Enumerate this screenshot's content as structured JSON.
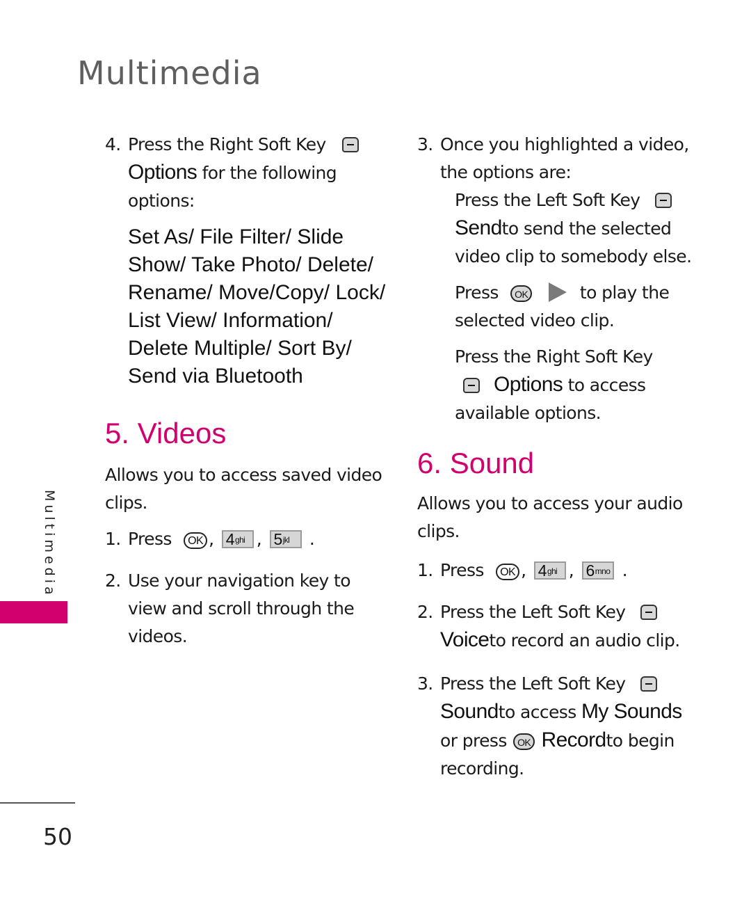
{
  "header": {
    "title": "Multimedia"
  },
  "side_tab": {
    "label": "Multimedia",
    "accent_color": "#d2006e"
  },
  "footer": {
    "page_number": "50"
  },
  "left_column": {
    "step4": {
      "num": "4.",
      "text_before": "Press the Right Soft Key",
      "key_label": "Options",
      "text_after_1": "for the following",
      "text_after_2": "options:",
      "options_lines": [
        "Set As/ File Filter/ Slide",
        "Show/ Take Photo/ Delete/",
        "Rename/ Move/Copy/ Lock/",
        "List View/ Information/",
        "Delete Multiple/ Sort By/",
        "Send via Bluetooth"
      ]
    },
    "videos": {
      "title": "5. Videos",
      "desc_1": "Allows you to access saved video",
      "desc_2": "clips.",
      "step1": {
        "num": "1.",
        "text": "Press",
        "keys": [
          "OK",
          "4",
          "ghi",
          "5",
          "jkl"
        ],
        "sep": ",",
        "end": "."
      },
      "step2": {
        "num": "2.",
        "lines": [
          "Use your navigation key to",
          "view and scroll through the",
          "videos."
        ]
      }
    }
  },
  "right_column": {
    "step3": {
      "num": "3.",
      "lines": [
        "Once you highlighted a video,",
        "the options are:"
      ],
      "sub1": {
        "text_before": "Press the Left Soft Key",
        "key_label": "Send",
        "text_after_1": "to send the selected",
        "text_after_2": "video clip to somebody else."
      },
      "sub2": {
        "text_before": "Press",
        "ok": "OK",
        "text_after_1": "to play the",
        "text_after_2": "selected video clip."
      },
      "sub3": {
        "text_before": "Press the Right Soft Key",
        "key_label": "Options",
        "text_after_1": "to access",
        "text_after_2": "available options."
      }
    },
    "sound": {
      "title": "6. Sound",
      "desc_1": "Allows you to access your audio",
      "desc_2": "clips.",
      "step1": {
        "num": "1.",
        "text": "Press",
        "keys": [
          "OK",
          "4",
          "ghi",
          "6",
          "mno"
        ],
        "sep": ",",
        "end": "."
      },
      "step2": {
        "num": "2.",
        "text_before": "Press the Left Soft Key",
        "key_label": "Voice",
        "text_after": "to record an audio clip."
      },
      "step3": {
        "num": "3.",
        "text_before": "Press the Left Soft Key",
        "key_label": "Sound",
        "text_mid": "to access",
        "target": "My Sounds",
        "text_or": "or press",
        "ok": "OK",
        "key_label_2": "Record",
        "text_after_1": "to begin",
        "text_after_2": "recording."
      }
    }
  }
}
